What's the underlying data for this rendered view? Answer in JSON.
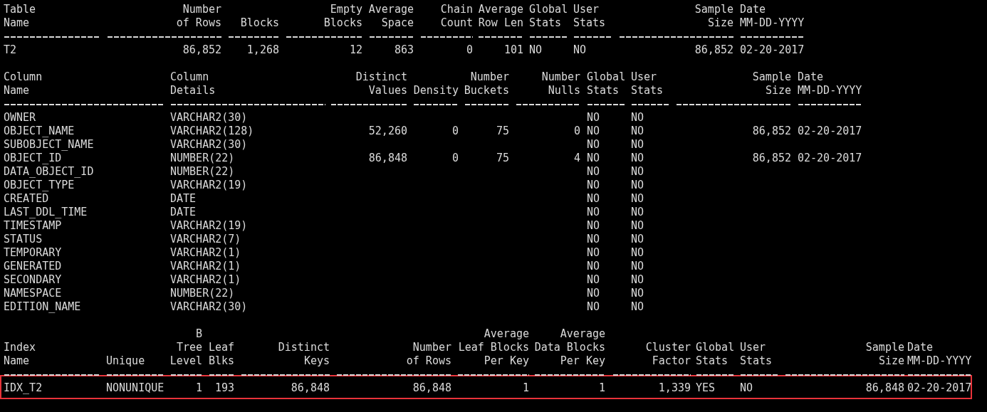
{
  "sections": [
    {
      "columns": [
        {
          "header": [
            "Table",
            "Name"
          ],
          "kind": "text"
        },
        {
          "header": [
            "Number",
            "of Rows"
          ],
          "kind": "number"
        },
        {
          "header": [
            "Blocks"
          ],
          "kind": "number"
        },
        {
          "header": [
            "Empty",
            "Blocks"
          ],
          "kind": "number"
        },
        {
          "header": [
            "Average",
            "Space"
          ],
          "kind": "number"
        },
        {
          "header": [
            "Chain",
            "Count"
          ],
          "kind": "number"
        },
        {
          "header": [
            "Average",
            "Row Len"
          ],
          "kind": "number"
        },
        {
          "header": [
            "Global",
            "Stats"
          ],
          "kind": "text"
        },
        {
          "header": [
            "User",
            "Stats"
          ],
          "kind": "text"
        },
        {
          "header": [
            "Sample",
            "Size"
          ],
          "kind": "number"
        },
        {
          "header": [
            "Date",
            "MM-DD-YYYY"
          ],
          "kind": "text"
        }
      ],
      "rows": [
        {
          "highlighted": false,
          "cells": [
            "T2",
            "86,852",
            "1,268",
            "12",
            "863",
            "0",
            "101",
            "NO",
            "NO",
            "86,852",
            "02-20-2017"
          ]
        }
      ]
    },
    {
      "columns": [
        {
          "header": [
            "Column",
            "Name"
          ],
          "kind": "text"
        },
        {
          "header": [
            "Column",
            "Details"
          ],
          "kind": "text"
        },
        {
          "header": [
            "Distinct",
            "Values"
          ],
          "kind": "number"
        },
        {
          "header": [
            "Density"
          ],
          "kind": "number"
        },
        {
          "header": [
            "Number",
            "Buckets"
          ],
          "kind": "number"
        },
        {
          "header": [
            "Number",
            "Nulls"
          ],
          "kind": "number"
        },
        {
          "header": [
            "Global",
            "Stats"
          ],
          "kind": "text"
        },
        {
          "header": [
            "User",
            "Stats"
          ],
          "kind": "text"
        },
        {
          "header": [
            "Sample",
            "Size"
          ],
          "kind": "number"
        },
        {
          "header": [
            "Date",
            "MM-DD-YYYY"
          ],
          "kind": "text"
        }
      ],
      "rows": [
        {
          "highlighted": false,
          "cells": [
            "OWNER",
            "VARCHAR2(30)",
            null,
            null,
            null,
            null,
            "NO",
            "NO",
            null,
            null
          ]
        },
        {
          "highlighted": false,
          "cells": [
            "OBJECT_NAME",
            "VARCHAR2(128)",
            "52,260",
            "0",
            "75",
            "0",
            "NO",
            "NO",
            "86,852",
            "02-20-2017"
          ]
        },
        {
          "highlighted": false,
          "cells": [
            "SUBOBJECT_NAME",
            "VARCHAR2(30)",
            null,
            null,
            null,
            null,
            "NO",
            "NO",
            null,
            null
          ]
        },
        {
          "highlighted": false,
          "cells": [
            "OBJECT_ID",
            "NUMBER(22)",
            "86,848",
            "0",
            "75",
            "4",
            "NO",
            "NO",
            "86,852",
            "02-20-2017"
          ]
        },
        {
          "highlighted": false,
          "cells": [
            "DATA_OBJECT_ID",
            "NUMBER(22)",
            null,
            null,
            null,
            null,
            "NO",
            "NO",
            null,
            null
          ]
        },
        {
          "highlighted": false,
          "cells": [
            "OBJECT_TYPE",
            "VARCHAR2(19)",
            null,
            null,
            null,
            null,
            "NO",
            "NO",
            null,
            null
          ]
        },
        {
          "highlighted": false,
          "cells": [
            "CREATED",
            "DATE",
            null,
            null,
            null,
            null,
            "NO",
            "NO",
            null,
            null
          ]
        },
        {
          "highlighted": false,
          "cells": [
            "LAST_DDL_TIME",
            "DATE",
            null,
            null,
            null,
            null,
            "NO",
            "NO",
            null,
            null
          ]
        },
        {
          "highlighted": false,
          "cells": [
            "TIMESTAMP",
            "VARCHAR2(19)",
            null,
            null,
            null,
            null,
            "NO",
            "NO",
            null,
            null
          ]
        },
        {
          "highlighted": false,
          "cells": [
            "STATUS",
            "VARCHAR2(7)",
            null,
            null,
            null,
            null,
            "NO",
            "NO",
            null,
            null
          ]
        },
        {
          "highlighted": false,
          "cells": [
            "TEMPORARY",
            "VARCHAR2(1)",
            null,
            null,
            null,
            null,
            "NO",
            "NO",
            null,
            null
          ]
        },
        {
          "highlighted": false,
          "cells": [
            "GENERATED",
            "VARCHAR2(1)",
            null,
            null,
            null,
            null,
            "NO",
            "NO",
            null,
            null
          ]
        },
        {
          "highlighted": false,
          "cells": [
            "SECONDARY",
            "VARCHAR2(1)",
            null,
            null,
            null,
            null,
            "NO",
            "NO",
            null,
            null
          ]
        },
        {
          "highlighted": false,
          "cells": [
            "NAMESPACE",
            "NUMBER(22)",
            null,
            null,
            null,
            null,
            "NO",
            "NO",
            null,
            null
          ]
        },
        {
          "highlighted": false,
          "cells": [
            "EDITION_NAME",
            "VARCHAR2(30)",
            null,
            null,
            null,
            null,
            "NO",
            "NO",
            null,
            null
          ]
        }
      ]
    },
    {
      "columns": [
        {
          "header": [
            "Index",
            "Name"
          ],
          "kind": "text"
        },
        {
          "header": [
            "Unique"
          ],
          "kind": "text"
        },
        {
          "header": [
            "B",
            "Tree",
            "Level"
          ],
          "kind": "number"
        },
        {
          "header": [
            "Leaf",
            "Blks"
          ],
          "kind": "number"
        },
        {
          "header": [
            "Distinct",
            "Keys"
          ],
          "kind": "number"
        },
        {
          "header": [
            "Number",
            "of Rows"
          ],
          "kind": "number"
        },
        {
          "header": [
            "Average",
            "Leaf Blocks",
            "Per Key"
          ],
          "kind": "number"
        },
        {
          "header": [
            "Average",
            "Data Blocks",
            "Per Key"
          ],
          "kind": "number"
        },
        {
          "header": [
            "Cluster",
            "Factor"
          ],
          "kind": "number"
        },
        {
          "header": [
            "Global",
            "Stats"
          ],
          "kind": "text"
        },
        {
          "header": [
            "User",
            "Stats"
          ],
          "kind": "text"
        },
        {
          "header": [
            "Sample",
            "Size"
          ],
          "kind": "number"
        },
        {
          "header": [
            "Date",
            "MM-DD-YYYY"
          ],
          "kind": "text"
        }
      ],
      "rows": [
        {
          "highlighted": true,
          "cells": [
            "IDX_T2",
            "NONUNIQUE",
            "1",
            "193",
            "86,848",
            "86,848",
            "1",
            "1",
            "1,339",
            "YES",
            "NO",
            "86,848",
            "02-20-2017"
          ]
        }
      ]
    }
  ]
}
